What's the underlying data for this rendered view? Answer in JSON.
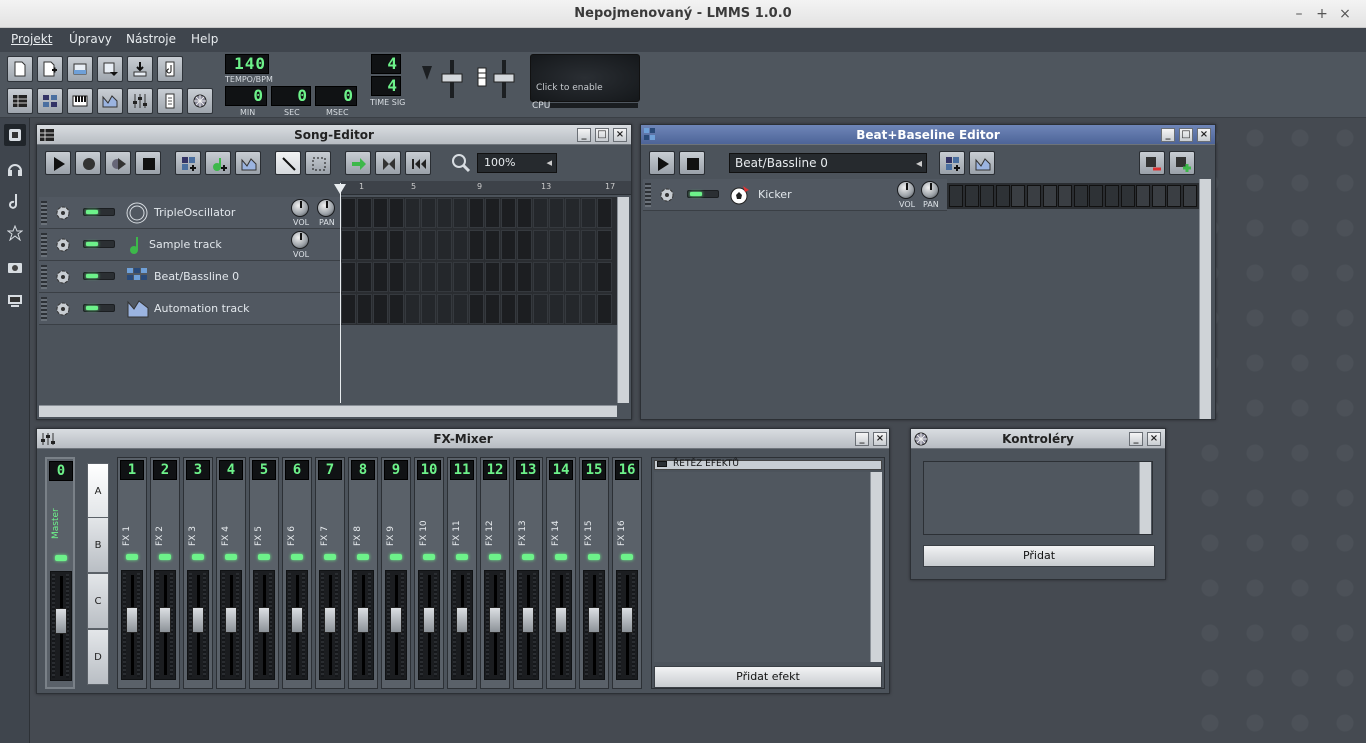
{
  "window": {
    "title": "Nepojmenovaný - LMMS 1.0.0",
    "minimize": "–",
    "maximize": "+",
    "close": "×"
  },
  "menu": [
    "Projekt",
    "Úpravy",
    "Nástroje",
    "Help"
  ],
  "toolbar": {
    "tempo": "140",
    "tempo_label": "TEMPO/BPM",
    "min": "0",
    "sec": "0",
    "msec": "0",
    "min_label": "MIN",
    "sec_label": "SEC",
    "msec_label": "MSEC",
    "timesig_num": "4",
    "timesig_den": "4",
    "timesig_label": "TIME SIG",
    "cpu_hint": "Click to enable",
    "cpu_label": "CPU"
  },
  "song_editor": {
    "title": "Song-Editor",
    "zoom": "100%",
    "ruler": [
      "1",
      "5",
      "9",
      "13",
      "17"
    ],
    "tracks": [
      {
        "name": "TripleOscillator",
        "vol": "VOL",
        "pan": "PAN"
      },
      {
        "name": "Sample track",
        "vol": "VOL"
      },
      {
        "name": "Beat/Bassline 0"
      },
      {
        "name": "Automation track"
      }
    ]
  },
  "bb_editor": {
    "title": "Beat+Baseline Editor",
    "selected": "Beat/Bassline 0",
    "tracks": [
      {
        "name": "Kicker",
        "vol": "VOL",
        "pan": "PAN"
      }
    ]
  },
  "fx_mixer": {
    "title": "FX-Mixer",
    "master": {
      "num": "0",
      "name": "Master"
    },
    "banks": [
      "A",
      "B",
      "C",
      "D"
    ],
    "channels": [
      {
        "num": "1",
        "name": "FX 1"
      },
      {
        "num": "2",
        "name": "FX 2"
      },
      {
        "num": "3",
        "name": "FX 3"
      },
      {
        "num": "4",
        "name": "FX 4"
      },
      {
        "num": "5",
        "name": "FX 5"
      },
      {
        "num": "6",
        "name": "FX 6"
      },
      {
        "num": "7",
        "name": "FX 7"
      },
      {
        "num": "8",
        "name": "FX 8"
      },
      {
        "num": "9",
        "name": "FX 9"
      },
      {
        "num": "10",
        "name": "FX 10"
      },
      {
        "num": "11",
        "name": "FX 11"
      },
      {
        "num": "12",
        "name": "FX 12"
      },
      {
        "num": "13",
        "name": "FX 13"
      },
      {
        "num": "14",
        "name": "FX 14"
      },
      {
        "num": "15",
        "name": "FX 15"
      },
      {
        "num": "16",
        "name": "FX 16"
      }
    ],
    "effect_chain": "ŘETĚZ EFEKTŮ",
    "add_effect": "Přidat efekt"
  },
  "controllers": {
    "title": "Kontroléry",
    "add": "Přidat"
  },
  "colors": {
    "lcd": "#6df28a",
    "active_title": "#5a70a6",
    "bg": "#4a5058"
  }
}
